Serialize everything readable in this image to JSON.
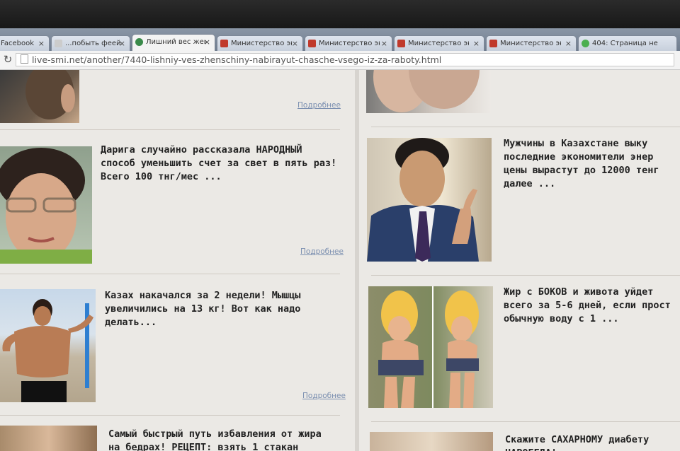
{
  "tabs": [
    {
      "label": "Facebook",
      "favicon_color": "#3b5998",
      "active": false
    },
    {
      "label": "...побыть феей",
      "favicon_color": "#cccccc",
      "active": false
    },
    {
      "label": "Лишний вес жен",
      "favicon_color": "#3a8a4a",
      "active": true
    },
    {
      "label": "Министерство эк",
      "favicon_color": "#c0392b",
      "active": false
    },
    {
      "label": "Министерство эк",
      "favicon_color": "#c0392b",
      "active": false
    },
    {
      "label": "Министерство эк",
      "favicon_color": "#c0392b",
      "active": false
    },
    {
      "label": "Министерство эк",
      "favicon_color": "#c0392b",
      "active": false
    },
    {
      "label": "404: Страница не",
      "favicon_color": "#4caf50",
      "active": false
    }
  ],
  "address_bar": {
    "url": "live-smi.net/another/7440-lishniy-ves-zhenschiny-nabirayut-chasche-vsego-iz-za-raboty.html"
  },
  "left_column": {
    "read_more_top": "Подробнее",
    "articles": [
      {
        "text": "Дарига случайно рассказала НАРОДНЫЙ\nспособ уменьшить счет за свет в пять раз!\nВсего 100 тнг/мес ...",
        "read_more": "Подробнее"
      },
      {
        "text": "Казах накачался за 2 недели! Мышцы\nувеличились на 13 кг! Вот как надо\nделать...",
        "read_more": "Подробнее"
      },
      {
        "text": "Самый быстрый путь избавления от жира\nна бедрах! РЕЦЕПТ: взять 1 стакан",
        "read_more": ""
      }
    ]
  },
  "right_column": {
    "articles": [
      {
        "text": "Мужчины в Казахстане выку\nпоследние экономители энер\nцены вырастут до 12000 тенг\nдалее ..."
      },
      {
        "text": "Жир с БОКОВ и живота уйдет\nвсего за 5-6 дней, если прост\nобычную воду с 1 ..."
      },
      {
        "text": "Скажите САХАРНОМУ диабету\nНАРОБЕДА!"
      }
    ]
  },
  "colors": {
    "link": "#7b8fb0",
    "page_bg": "#ebe9e5",
    "headline": "#222222"
  }
}
